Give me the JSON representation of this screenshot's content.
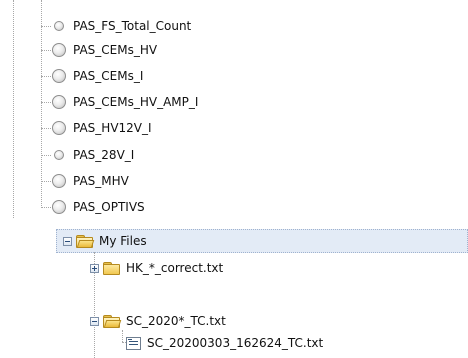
{
  "channels": [
    {
      "label": "PAS_FS_Total_Count",
      "led_size": "small"
    },
    {
      "label": "PAS_CEMs_HV",
      "led_size": "normal"
    },
    {
      "label": "PAS_CEMs_I",
      "led_size": "normal"
    },
    {
      "label": "PAS_CEMs_HV_AMP_I",
      "led_size": "normal"
    },
    {
      "label": "PAS_HV12V_I",
      "led_size": "normal"
    },
    {
      "label": "PAS_28V_I",
      "led_size": "small"
    },
    {
      "label": "PAS_MHV",
      "led_size": "normal"
    },
    {
      "label": "PAS_OPTIVS",
      "led_size": "normal"
    }
  ],
  "file_tree": {
    "root": {
      "label": "My Files",
      "expanded": true,
      "selected": true
    },
    "items": [
      {
        "label": "HK_*_correct.txt",
        "type": "folder",
        "expanded": false
      },
      {
        "label": "SC_2020*_TC.txt",
        "type": "folder",
        "expanded": true,
        "children": [
          {
            "label": "SC_20200303_162624_TC.txt",
            "type": "file"
          }
        ]
      }
    ]
  },
  "colors": {
    "selection_bg": "#e3ebf6",
    "folder": "#f1c851",
    "tree_line": "#a8a8a8"
  }
}
